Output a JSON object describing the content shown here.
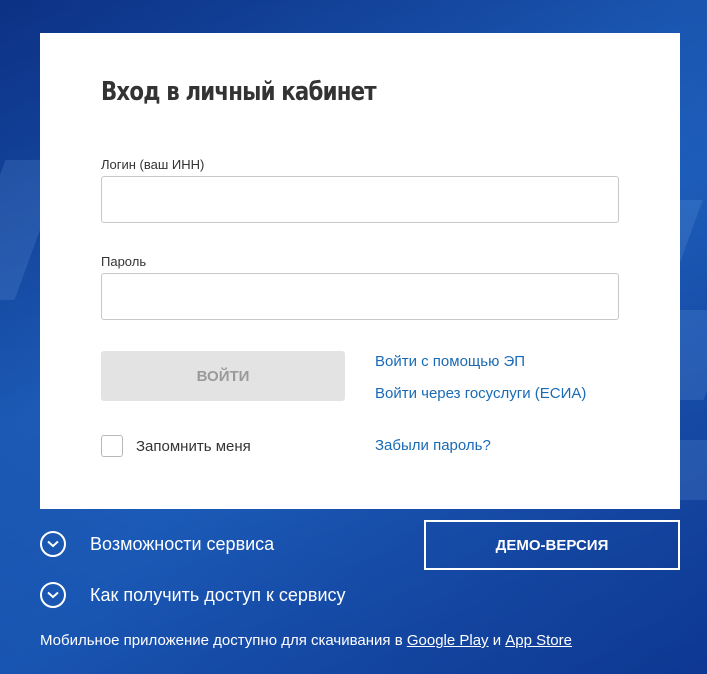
{
  "login_form": {
    "title": "Вход в личный кабинет",
    "login_label": "Логин (ваш ИНН)",
    "login_value": "",
    "password_label": "Пароль",
    "password_value": "",
    "submit_label": "ВОЙТИ",
    "ep_link": "Войти с помощью ЭП",
    "esia_link": "Войти через госуслуги (ЕСИА)",
    "remember_label": "Запомнить меня",
    "remember_checked": false,
    "forgot_link": "Забыли пароль?"
  },
  "info": {
    "features_label": "Возможности сервиса",
    "access_label": "Как получить доступ к сервису",
    "demo_label": "ДЕМО-ВЕРСИЯ"
  },
  "footer": {
    "text_before": "Мобильное приложение доступно для скачивания в ",
    "google_play": "Google Play",
    "conjunction": " и ",
    "app_store": "App Store"
  },
  "colors": {
    "background": "#1d4fa3",
    "link": "#1a6ab5",
    "button_disabled_bg": "#e3e3e3",
    "button_disabled_text": "#9a9a9a"
  },
  "icons": {
    "expand": "chevron-down-circle-icon"
  }
}
